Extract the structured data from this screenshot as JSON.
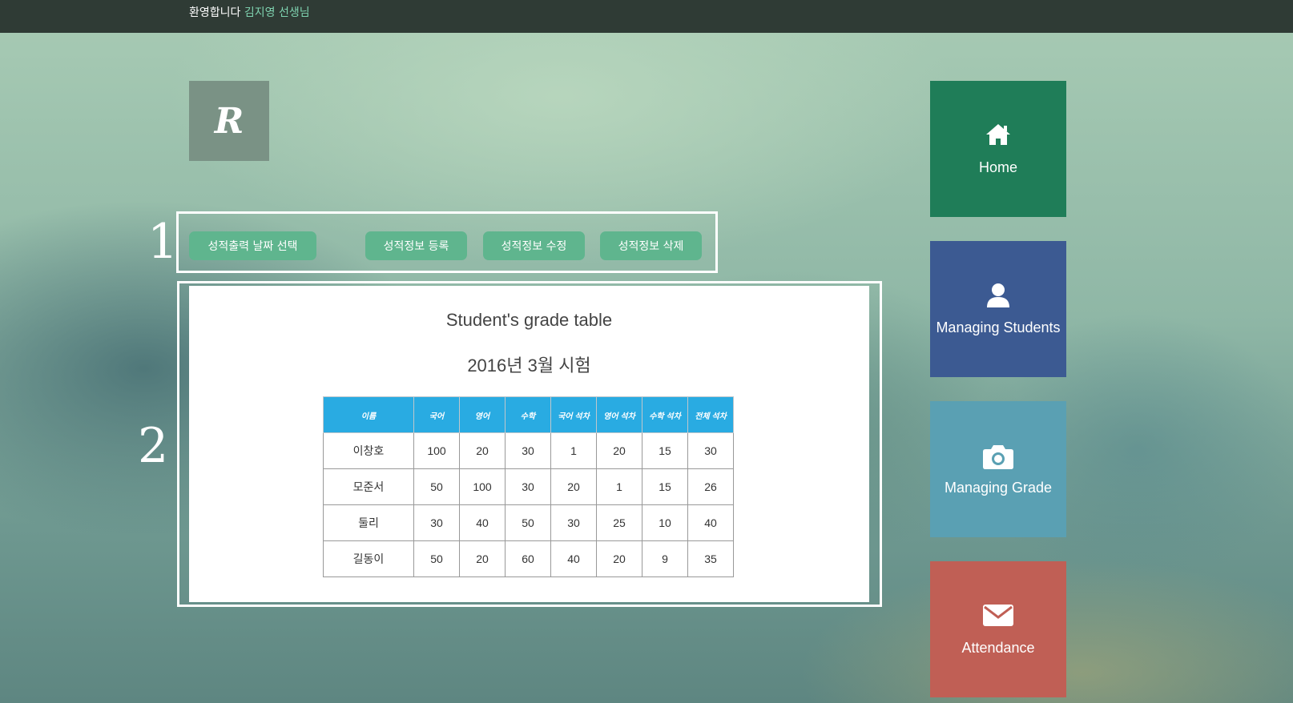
{
  "header": {
    "welcome_text": "환영합니다",
    "teacher_name": "김지영 선생님"
  },
  "logo": {
    "letter": "R"
  },
  "annotations": {
    "marker1": "1",
    "marker2": "2"
  },
  "toolbar": {
    "select_date": "성적출력 날짜 선택",
    "register": "성적정보 등록",
    "edit": "성적정보 수정",
    "delete": "성적정보 삭제"
  },
  "grade_panel": {
    "title": "Student's grade table",
    "subtitle": "2016년 3월 시험",
    "columns": [
      "이름",
      "국어",
      "영어",
      "수학",
      "국어 석차",
      "영어 석차",
      "수학 석차",
      "전체 석차"
    ],
    "rows": [
      [
        "이창호",
        "100",
        "20",
        "30",
        "1",
        "20",
        "15",
        "30"
      ],
      [
        "모준서",
        "50",
        "100",
        "30",
        "20",
        "1",
        "15",
        "26"
      ],
      [
        "둘리",
        "30",
        "40",
        "50",
        "30",
        "25",
        "10",
        "40"
      ],
      [
        "길동이",
        "50",
        "20",
        "60",
        "40",
        "20",
        "9",
        "35"
      ]
    ]
  },
  "nav": {
    "home": "Home",
    "students": "Managing Students",
    "grade": "Managing Grade",
    "attendance": "Attendance"
  },
  "colors": {
    "topbar": "#2f3b35",
    "button": "#5fb58e",
    "table_header": "#29abe2",
    "tile_home": "#1f7d58",
    "tile_students": "#3c5a92",
    "tile_grade": "#5aa0b3",
    "tile_attendance": "#c05f55"
  },
  "icons": {
    "home": "home-icon",
    "students": "user-icon",
    "grade": "camera-icon",
    "attendance": "envelope-icon"
  }
}
